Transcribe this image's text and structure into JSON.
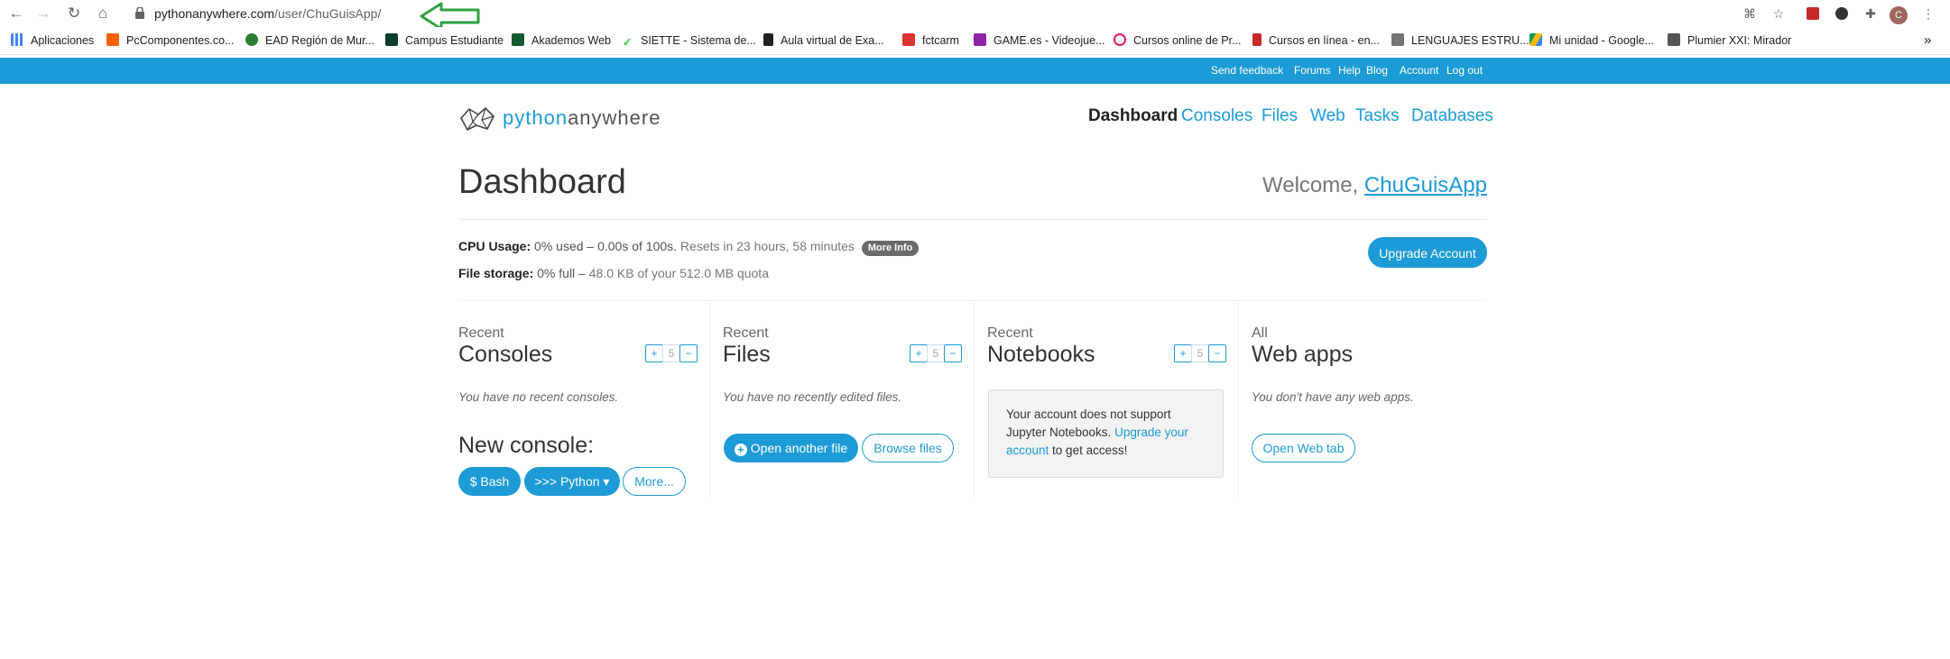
{
  "browser": {
    "url_host": "pythonanywhere.com",
    "url_path": "/user/ChuGuisApp/",
    "bookmarks": [
      {
        "label": "Aplicaciones",
        "color": "#4285f4"
      },
      {
        "label": "PcComponentes.co...",
        "color": "#ff6000"
      },
      {
        "label": "EAD Región de Mur...",
        "color": "#2e7d32"
      },
      {
        "label": "Campus Estudiante",
        "color": "#0b3d2e"
      },
      {
        "label": "Akademos Web",
        "color": "#145a32"
      },
      {
        "label": "SIETTE - Sistema de...",
        "color": "#2ecc40"
      },
      {
        "label": "Aula virtual de Exa...",
        "color": "#222222"
      },
      {
        "label": "fctcarm",
        "color": "#dd3333"
      },
      {
        "label": "GAME.es - Videojue...",
        "color": "#8e24aa"
      },
      {
        "label": "Cursos online de Pr...",
        "color": "#d81b60"
      },
      {
        "label": "Cursos en línea - en...",
        "color": "#c62828"
      },
      {
        "label": "LENGUAJES ESTRU...",
        "color": "#757575"
      },
      {
        "label": "Mi unidad - Google...",
        "color": "#fbbc05"
      },
      {
        "label": "Plumier XXI: Mirador",
        "color": "#555555"
      }
    ],
    "overflow": "»"
  },
  "topbar": {
    "links": [
      "Send feedback",
      "Forums",
      "Help",
      "Blog",
      "Account",
      "Log out"
    ]
  },
  "logo": {
    "part1": "python",
    "part2": "anywhere"
  },
  "nav": {
    "items": [
      "Dashboard",
      "Consoles",
      "Files",
      "Web",
      "Tasks",
      "Databases"
    ]
  },
  "page": {
    "title": "Dashboard",
    "welcome_prefix": "Welcome, ",
    "username": "ChuGuisApp"
  },
  "usage": {
    "cpu_label": "CPU Usage:",
    "cpu_value": "0% used – 0.00s of 100s.",
    "cpu_reset": "Resets in 23 hours, 58 minutes",
    "more_info": "More Info",
    "storage_label": "File storage:",
    "storage_value": "0% full –",
    "storage_detail": "48.0 KB of your 512.0 MB quota",
    "upgrade": "Upgrade Account"
  },
  "sections": {
    "consoles": {
      "small": "Recent",
      "big": "Consoles",
      "count": "5",
      "empty": "You have no recent consoles."
    },
    "files": {
      "small": "Recent",
      "big": "Files",
      "count": "5",
      "empty": "You have no recently edited files."
    },
    "notebooks": {
      "small": "Recent",
      "big": "Notebooks",
      "count": "5",
      "notice_pre": "Your account does not support Jupyter Notebooks. ",
      "notice_link": "Upgrade your account",
      "notice_post": " to get access!"
    },
    "webapps": {
      "small": "All",
      "big": "Web apps",
      "empty": "You don't have any web apps."
    }
  },
  "new_console": {
    "title": "New console:",
    "bash": "$ Bash",
    "python": ">>> Python ▾",
    "more": "More..."
  },
  "files_actions": {
    "open": "Open another file",
    "browse": "Browse files"
  },
  "webapps_actions": {
    "open_tab": "Open Web tab"
  },
  "stepper": {
    "plus": "+",
    "minus": "−"
  },
  "colors": {
    "accent": "#1d9bd7",
    "annotation_arrow": "#2ea043"
  }
}
